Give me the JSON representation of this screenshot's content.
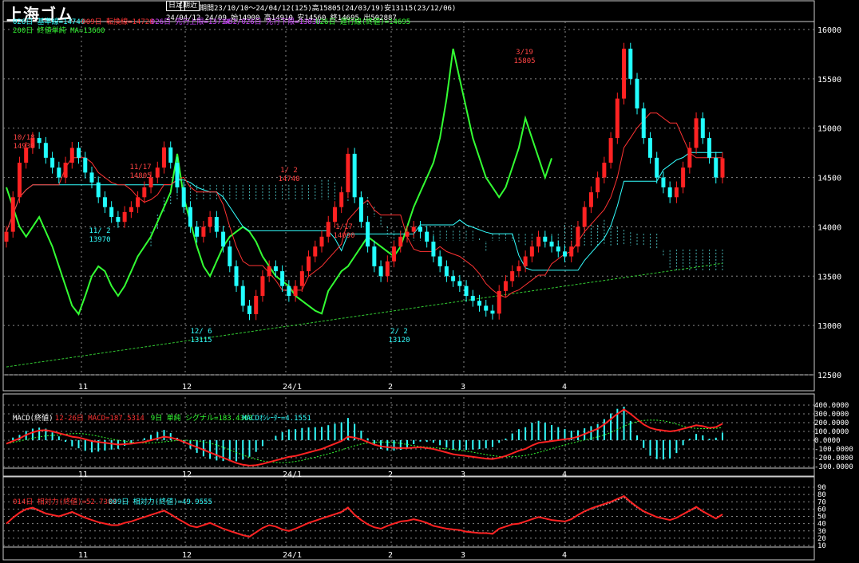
{
  "title": "上海ゴム",
  "tabs": [
    "日足",
    "期近"
  ],
  "header": {
    "range_line": "期間23/10/10～24/04/12(125)高15805(24/03/19)安13115(23/12/06)",
    "ohlc_line": "24/04/12 24/09 始14900 高14910 安14560 終14695 出502887"
  },
  "legend_main": [
    {
      "text": "026日 基準線=14740",
      "color": "#33ffff"
    },
    {
      "text": "009日 転換線=14728",
      "color": "#ff3333"
    },
    {
      "text": "026日 先行上限=13714",
      "color": "#cc44ff"
    },
    {
      "text": "052/026日 先行下限=13830",
      "color": "#cc44ff"
    },
    {
      "text": "026日 遅行線(終値)=14695",
      "color": "#33ff33"
    },
    {
      "text": "200日 終値単純 MA=13660",
      "color": "#33ff33"
    }
  ],
  "legend_macd": [
    {
      "text": "MACD(終値)",
      "color": "#ffffff"
    },
    {
      "text": "12-26日 MACD=187.5314",
      "color": "#ff3333"
    },
    {
      "text": "9日 単純 シグナル=183.4363",
      "color": "#33ff33"
    },
    {
      "text": "MACDｵｼﾚｰﾀｰ=4.1551",
      "color": "#33ffff"
    }
  ],
  "legend_rsi": [
    {
      "text": "014日 相対力(終値)=52.7383",
      "color": "#ff3333"
    },
    {
      "text": "009日 相対力(終値)=49.9555",
      "color": "#33ffff"
    }
  ],
  "colors": {
    "up": "#ff2222",
    "down": "#22ffff",
    "grid": "#888888"
  },
  "chart_data": {
    "type": "candlestick",
    "x_labels": [
      "11",
      "12",
      "24/1",
      "2",
      "3",
      "4"
    ],
    "y_ticks": [
      "16000",
      "15500",
      "15000",
      "14500",
      "14000",
      "13500",
      "13000",
      "12500"
    ],
    "ylim": [
      12500,
      16000
    ],
    "annotations": [
      {
        "date": "10/18",
        "value": "14930"
      },
      {
        "date": "11/17",
        "value": "14805"
      },
      {
        "date": "11/ 2",
        "value": "13970"
      },
      {
        "date": "12/ 6",
        "value": "13115"
      },
      {
        "date": "1/ 2",
        "value": "14740"
      },
      {
        "date": "1/17",
        "value": "14090"
      },
      {
        "date": "2/ 2",
        "value": "13120"
      },
      {
        "date": "3/19",
        "value": "15805"
      }
    ],
    "close": [
      13950,
      14300,
      14650,
      14800,
      14900,
      14850,
      14700,
      14600,
      14500,
      14650,
      14800,
      14700,
      14550,
      14450,
      14300,
      14200,
      14100,
      14050,
      14150,
      14200,
      14300,
      14400,
      14500,
      14600,
      14805,
      14650,
      14400,
      14200,
      14000,
      13900,
      14000,
      14100,
      13950,
      13800,
      13600,
      13400,
      13200,
      13115,
      13300,
      13500,
      13600,
      13550,
      13400,
      13300,
      13400,
      13550,
      13700,
      13800,
      13900,
      14050,
      14200,
      14350,
      14740,
      14300,
      14050,
      13800,
      13600,
      13500,
      13650,
      13800,
      13900,
      13950,
      14000,
      13950,
      13850,
      13700,
      13600,
      13500,
      13450,
      13400,
      13300,
      13250,
      13200,
      13150,
      13120,
      13350,
      13450,
      13550,
      13600,
      13700,
      13800,
      13900,
      13850,
      13800,
      13750,
      13700,
      13800,
      14000,
      14200,
      14350,
      14500,
      14650,
      14900,
      15300,
      15805,
      15500,
      15200,
      14900,
      14700,
      14500,
      14400,
      14300,
      14400,
      14600,
      14800,
      15100,
      14900,
      14700,
      14500,
      14695
    ],
    "macd": [
      -40,
      -10,
      20,
      60,
      90,
      110,
      115,
      100,
      80,
      60,
      40,
      30,
      10,
      -10,
      -20,
      -30,
      -40,
      -50,
      -45,
      -40,
      -30,
      -20,
      0,
      20,
      40,
      30,
      10,
      -20,
      -50,
      -80,
      -110,
      -140,
      -170,
      -200,
      -230,
      -260,
      -280,
      -290,
      -285,
      -270,
      -250,
      -230,
      -210,
      -190,
      -180,
      -160,
      -140,
      -120,
      -100,
      -70,
      -40,
      -10,
      40,
      30,
      10,
      -20,
      -50,
      -70,
      -80,
      -85,
      -90,
      -90,
      -85,
      -80,
      -90,
      -100,
      -120,
      -140,
      -160,
      -170,
      -180,
      -190,
      -200,
      -210,
      -215,
      -200,
      -180,
      -150,
      -120,
      -100,
      -60,
      -30,
      -20,
      -10,
      0,
      10,
      20,
      40,
      70,
      100,
      130,
      180,
      240,
      300,
      350,
      300,
      240,
      180,
      140,
      120,
      110,
      100,
      110,
      130,
      150,
      170,
      160,
      140,
      150,
      187.53
    ],
    "rsi": [
      40,
      48,
      55,
      60,
      62,
      58,
      54,
      52,
      50,
      53,
      56,
      52,
      48,
      45,
      42,
      40,
      38,
      38,
      41,
      43,
      46,
      49,
      52,
      55,
      58,
      53,
      47,
      42,
      37,
      35,
      38,
      41,
      37,
      33,
      30,
      27,
      24,
      22,
      28,
      34,
      38,
      36,
      32,
      30,
      33,
      37,
      41,
      44,
      47,
      50,
      53,
      56,
      62,
      52,
      45,
      39,
      35,
      33,
      37,
      40,
      43,
      44,
      46,
      44,
      41,
      37,
      35,
      33,
      32,
      31,
      29,
      28,
      27,
      27,
      26,
      33,
      36,
      39,
      40,
      43,
      46,
      49,
      47,
      45,
      44,
      43,
      46,
      52,
      57,
      61,
      64,
      67,
      70,
      74,
      78,
      70,
      63,
      57,
      53,
      49,
      47,
      45,
      48,
      53,
      58,
      63,
      57,
      52,
      47,
      52.74
    ],
    "axes": {
      "macd_ticks": [
        "400.0000",
        "300.0000",
        "200.0000",
        "100.0000",
        "0.0000",
        "-100.0000",
        "-200.0000",
        "-300.0000"
      ],
      "rsi_ticks": [
        "90",
        "80",
        "70",
        "60",
        "50",
        "40",
        "30",
        "20",
        "10"
      ]
    }
  }
}
